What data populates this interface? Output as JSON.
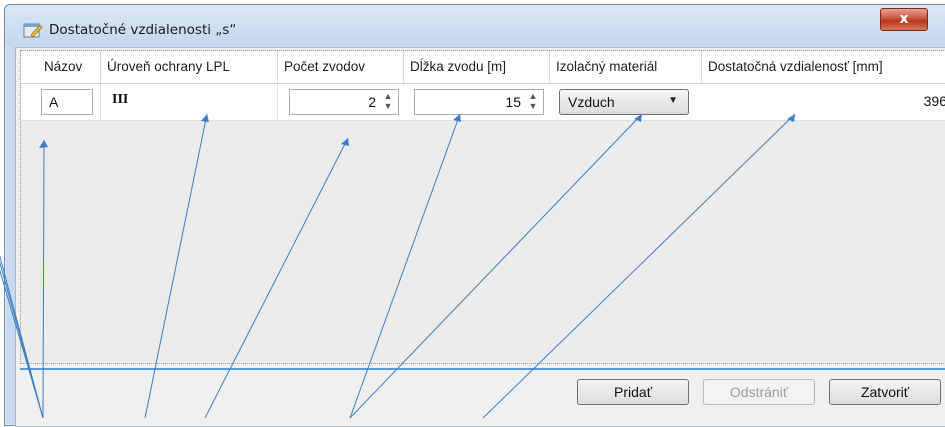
{
  "window": {
    "title": "Dostatočné vzdialenosti „s“",
    "close_label": "x"
  },
  "grid": {
    "columns": [
      "Názov",
      "Úroveň ochrany LPL",
      "Počet zvodov",
      "Dĺžka zvodu [m]",
      "Izolačný materiál",
      "Dostatočná vzdialenosť [mm]"
    ],
    "row": {
      "name": "A",
      "lpl": "III",
      "count": "2",
      "length": "15",
      "material": "Vzduch",
      "distance": "396"
    }
  },
  "buttons": {
    "add": "Pridať",
    "remove": "Odstrániť",
    "close": "Zatvoriť"
  }
}
